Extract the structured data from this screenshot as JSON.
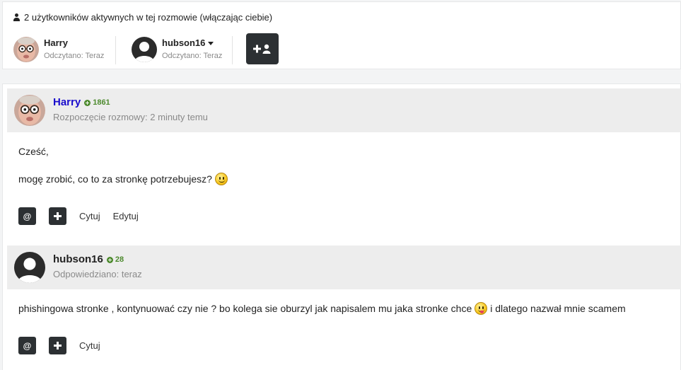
{
  "participants": {
    "active_text": "2 użytkowników aktywnych w tej rozmowie (włączając ciebie)",
    "users": [
      {
        "name": "Harry",
        "read": "Odczytano: Teraz"
      },
      {
        "name": "hubson16",
        "read": "Odczytano: Teraz"
      }
    ],
    "add_icon": "plus-user-icon"
  },
  "messages": [
    {
      "author": "Harry",
      "reputation": "1861",
      "meta": "Rozpoczęcie rozmowy: 2 minuty temu",
      "line1": "Cześć,",
      "line2": "mogę zrobić, co to za stronkę potrzebujesz?",
      "emoji": "smile-emoji",
      "actions": {
        "mention": "@",
        "quote": "Cytuj",
        "edit": "Edytuj"
      }
    },
    {
      "author": "hubson16",
      "reputation": "28",
      "meta": "Odpowiedziano: teraz",
      "text_before": "phishingowa stronke , kontynuować czy nie ? bo kolega sie oburzyl jak napisalem mu jaka stronke chce",
      "text_after": "i dlatego nazwał mnie scamem",
      "emoji": "tongue-emoji",
      "actions": {
        "mention": "@",
        "quote": "Cytuj"
      }
    }
  ],
  "colors": {
    "dark_button": "#2c3033",
    "author_link": "#1a0dcc",
    "reputation": "#4d8a2e",
    "meta": "#8a8a8a"
  }
}
